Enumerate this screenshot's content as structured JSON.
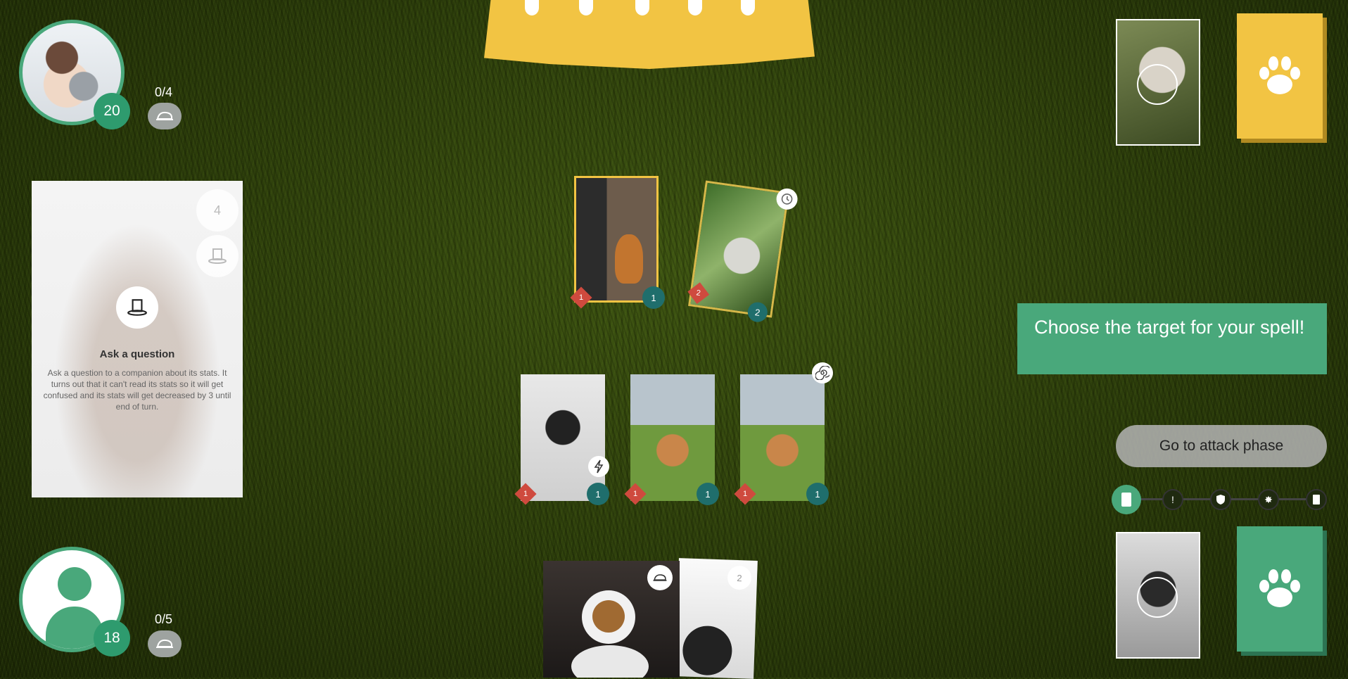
{
  "opponent": {
    "life": "20",
    "food": "0/4"
  },
  "player": {
    "life": "18",
    "food": "0/5"
  },
  "zoomed_card": {
    "cost": "4",
    "title": "Ask a question",
    "description": "Ask a question to a companion about its stats. It turns out that it can't read its stats so it will get confused and its stats will get decreased by 3 until end of turn."
  },
  "opponent_board": [
    {
      "attack": "1",
      "health": "1"
    },
    {
      "attack": "2",
      "health": "2"
    }
  ],
  "player_board": [
    {
      "attack": "1",
      "health": "1"
    },
    {
      "attack": "1",
      "health": "1"
    },
    {
      "attack": "1",
      "health": "1"
    }
  ],
  "hand": [
    {
      "badge": "food-icon"
    },
    {
      "cost": "2"
    }
  ],
  "prompt": "Choose the target for your spell!",
  "attack_button": "Go to attack phase",
  "phases": [
    "card-icon",
    "exclamation-icon",
    "shield-icon",
    "burst-icon",
    "card-icon"
  ],
  "colors": {
    "accent_green": "#49a87b",
    "deck_yellow": "#f2c443",
    "attack_red": "#cf4a3e",
    "health_teal": "#1f6e6c"
  }
}
